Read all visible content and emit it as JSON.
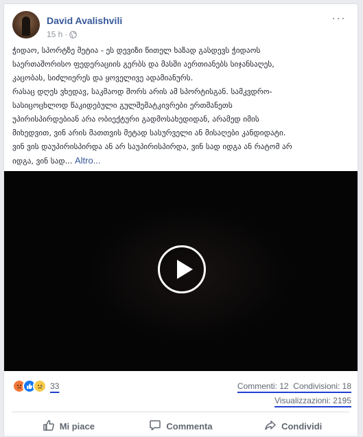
{
  "post": {
    "author": "David Avalishvili",
    "time": "15 h",
    "dot": "·",
    "privacy_icon": "globe-icon",
    "more_icon": "more-options-icon",
    "text_lines": [
      "ჭიდაო, სპორტზე მეტია - ეს დევიზი წითელ ხაზად გასდევს ჭიდაოს",
      "საერთაშორისო ფედერაციის გერბს და მასში აერთიანებს სიჯანსაღეს,",
      "კაცობას, სიძლიერეს და ყოველივე ადამიანურს.",
      "რასაც დღეს ვხედავ, საკმაოდ შორს არის ამ სპორტისგან. სამკვდრო-",
      "სასიცოცხლოდ წაკიდებული გულშემატკივრები ერთმანეთს",
      "უპირისპირდებიან არა ობიექტური გადმოსახედიდან, არამედ იმის",
      "მიხედვით, ვინ არის მათთვის მეტად სასურველი ან მისაღები კანდიდატი.",
      "ვინ ვის დაუპირისპირდა ან არ საუპირისპირდა, ვინ სად იდგა ან რატომ არ"
    ],
    "last_line": "იდგა, ვინ სად...",
    "more_link": "Altro..."
  },
  "video": {
    "play_icon": "play-icon"
  },
  "stats": {
    "reaction_icons": [
      "angry-icon",
      "like-icon",
      "sad-icon"
    ],
    "reaction_count": "33",
    "comments": "Commenti: 12",
    "shares": "Condivisioni: 18",
    "views": "Visualizzazioni: 2195"
  },
  "actions": {
    "like": "Mi piace",
    "comment": "Commenta",
    "share": "Condividi"
  },
  "colors": {
    "link": "#365899",
    "annotation_underline": "#1f3fd0",
    "like_blue": "#1877f2",
    "angry_orange": "#f0783a",
    "sad_yellow": "#f7c94a"
  }
}
